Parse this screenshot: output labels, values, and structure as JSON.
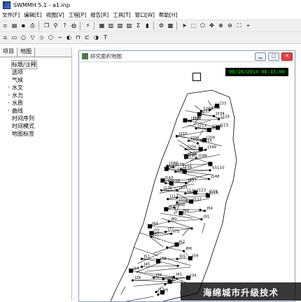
{
  "window": {
    "title": "SWMMH 5.1 - a1.inp"
  },
  "menu": [
    "文件[F]",
    "编辑[E]",
    "视图[V]",
    "工程[P]",
    "报告[R]",
    "工具[T]",
    "窗口[W]",
    "帮助[H]"
  ],
  "toolbar1": [
    {
      "name": "new-icon",
      "glyph": "▫"
    },
    {
      "name": "open-icon",
      "glyph": "▤"
    },
    {
      "name": "save-icon",
      "glyph": "▪"
    },
    {
      "name": "print-icon",
      "glyph": "⎙"
    },
    {
      "sep": true
    },
    {
      "name": "copy-icon",
      "glyph": "❐"
    },
    {
      "name": "find-icon",
      "glyph": "⚲"
    },
    {
      "name": "query-icon",
      "glyph": "?"
    },
    {
      "name": "globe-icon",
      "glyph": "◍"
    },
    {
      "sep": true
    },
    {
      "name": "run-icon",
      "glyph": "⚡"
    },
    {
      "sep": true
    },
    {
      "name": "table-icon",
      "glyph": "▦"
    },
    {
      "name": "graph-icon",
      "glyph": "▥"
    },
    {
      "name": "chart-icon",
      "glyph": "▧"
    },
    {
      "name": "profile-icon",
      "glyph": "▨"
    },
    {
      "name": "stats-icon",
      "glyph": "Σ"
    },
    {
      "name": "bars-icon",
      "glyph": "▮"
    },
    {
      "sep": true
    },
    {
      "name": "options-icon",
      "glyph": "⚙"
    },
    {
      "name": "tile-icon",
      "glyph": "▩"
    },
    {
      "sep": true
    },
    {
      "name": "select-icon",
      "glyph": "➤"
    },
    {
      "name": "vertex-icon",
      "glyph": "⬚"
    },
    {
      "name": "region-icon",
      "glyph": "⬠"
    },
    {
      "name": "pan-icon",
      "glyph": "✥"
    },
    {
      "name": "zoom-in-icon",
      "glyph": "⊕"
    },
    {
      "name": "zoom-out-icon",
      "glyph": "⊖"
    },
    {
      "name": "full-extent-icon",
      "glyph": "⛶"
    },
    {
      "name": "measure-icon",
      "glyph": "⌖"
    }
  ],
  "toolbar2": [
    {
      "name": "raingage-icon",
      "glyph": "⌂"
    },
    {
      "name": "subcatch-icon",
      "glyph": "▭"
    },
    {
      "name": "junction-icon",
      "glyph": "○"
    },
    {
      "name": "outfall-icon",
      "glyph": "▽"
    },
    {
      "name": "divider-icon",
      "glyph": "◇"
    },
    {
      "name": "storage-icon",
      "glyph": "⬡"
    },
    {
      "name": "conduit-icon",
      "glyph": "─"
    },
    {
      "name": "pump-icon",
      "glyph": "◐"
    },
    {
      "name": "orifice-icon",
      "glyph": "⊓"
    },
    {
      "name": "weir-icon",
      "glyph": "⊏"
    },
    {
      "name": "outlet-icon",
      "glyph": "◑"
    },
    {
      "name": "label-icon",
      "glyph": "T"
    }
  ],
  "sidebar": {
    "tabs": [
      "项目",
      "地图"
    ],
    "items": [
      {
        "label": "标题/注释",
        "exp": "",
        "selected": true
      },
      {
        "label": "选项",
        "exp": ""
      },
      {
        "label": "气候",
        "exp": ""
      },
      {
        "label": "水文",
        "exp": "›"
      },
      {
        "label": "水力",
        "exp": "›"
      },
      {
        "label": "水质",
        "exp": "›"
      },
      {
        "label": "曲线",
        "exp": "›"
      },
      {
        "label": "时间序列",
        "exp": ""
      },
      {
        "label": "时间模式",
        "exp": ""
      },
      {
        "label": "地图标签",
        "exp": ""
      }
    ]
  },
  "map": {
    "title": "研究面积地图",
    "datetime": "06/16/2019 00:15:00",
    "labels": [
      "233",
      "J132",
      "S260",
      "J237",
      "J234",
      "J229",
      "J225",
      "J228",
      "J223",
      "J213",
      "S220",
      "J222",
      "J210",
      "J209",
      "J206",
      "SS115",
      "J204",
      "J199",
      "J196",
      "J190",
      "J188",
      "J180",
      "J175",
      "J157",
      "J156",
      "SS110",
      "J153",
      "J148",
      "J143",
      "J137",
      "SS118",
      "J125",
      "J126",
      "J123",
      "J121",
      "J119",
      "J116",
      "J113",
      "J111",
      "J104",
      "J100",
      "J97",
      "J94",
      "J90",
      "J91",
      "J80",
      "J84",
      "J77",
      "J75",
      "J71",
      "J67",
      "J62",
      "J66",
      "J59",
      "J55",
      "J51",
      "J48",
      "J45",
      "J44",
      "J41",
      "J36",
      "J34",
      "J28",
      "J24",
      "J19",
      "J13",
      "J9"
    ]
  },
  "watermark": "海绵城市升级技术"
}
